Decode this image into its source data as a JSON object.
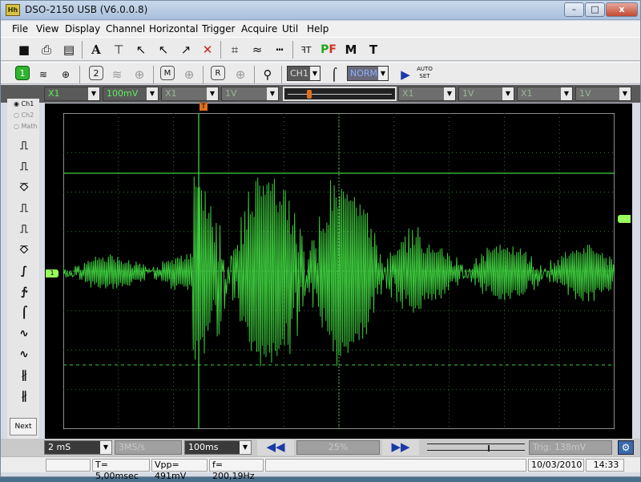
{
  "window": {
    "title": "DSO-2150 USB (V6.0.0.8)",
    "icon_text": "Hh"
  },
  "titlebar_buttons": {
    "minimize": "–",
    "maximize": "□",
    "close": "x"
  },
  "menu": [
    "File",
    "View",
    "Display",
    "Channel",
    "Horizontal",
    "Trigger",
    "Acquire",
    "Util",
    "Help"
  ],
  "toolbar2": {
    "channel_select": "CH1",
    "trigger_mode": "NORM",
    "auto_set_line1": "AUTO",
    "auto_set_line2": "SET",
    "ch1_badge": "1",
    "ch2_badge": "2",
    "math_badge": "M",
    "ref_badge": "R"
  },
  "channel_bar": {
    "ch1_probe": "X1",
    "ch1_volts": "100mV",
    "ch2_probe": "X1",
    "ch2_volts": "1V",
    "ch3_probe": "X1",
    "ch3_volts": "1V",
    "ch4_probe": "X1",
    "ch4_volts": "1V"
  },
  "left_panel": {
    "radio_ch1": "Ch1",
    "radio_ch2": "Ch2",
    "radio_math": "Math",
    "next": "Next"
  },
  "scope_markers": {
    "ch1_level": "1",
    "trigger_level": "T"
  },
  "bottom_controls": {
    "timebase": "2 mS",
    "sample_rate": "3MS/s",
    "record": "100ms",
    "scroll_pos": "25%",
    "trigger_level": "Trig: 138mV"
  },
  "status": {
    "period": "T= 5,00msec",
    "vpp": "Vpp= 491mV",
    "freq": "f= 200,19Hz",
    "date": "10/03/2010",
    "time": "14:33"
  },
  "colors": {
    "trace": "#3cc83c",
    "grid": "#2e7a2e",
    "cursor": "#3cd03c",
    "background": "#000000"
  }
}
